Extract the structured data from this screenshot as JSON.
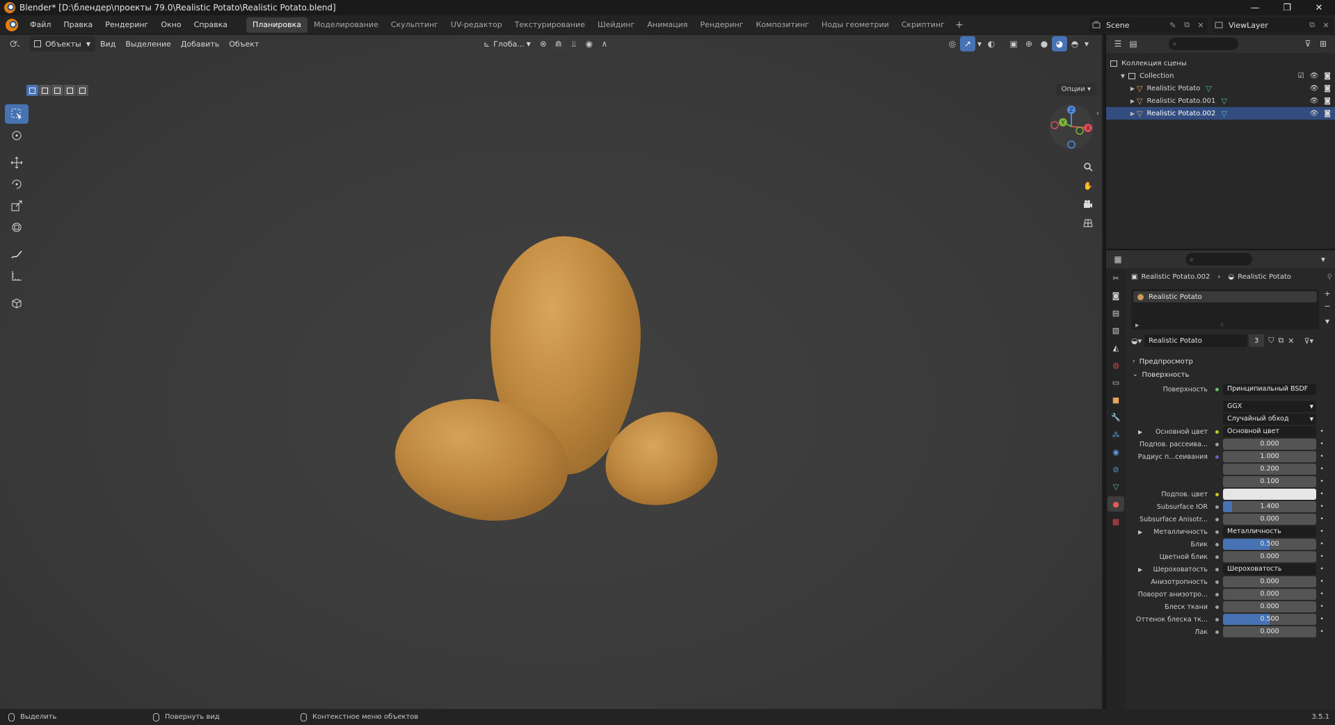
{
  "window": {
    "title": "Blender* [D:\\блендер\\проекты 79.0\\Realistic Potato\\Realistic Potato.blend]",
    "controls": [
      "—",
      "❐",
      "✕"
    ]
  },
  "menu": [
    "Файл",
    "Правка",
    "Рендеринг",
    "Окно",
    "Справка"
  ],
  "workspaces": {
    "tabs": [
      "Планировка",
      "Моделирование",
      "Скульптинг",
      "UV-редактор",
      "Текстурирование",
      "Шейдинг",
      "Анимация",
      "Рендеринг",
      "Композитинг",
      "Ноды геометрии",
      "Скриптинг"
    ],
    "active": "Планировка",
    "plus": "+"
  },
  "scene": {
    "name": "Scene"
  },
  "view_layer": {
    "name": "ViewLayer"
  },
  "viewport": {
    "mode": "Объекты",
    "menus": [
      "Вид",
      "Выделение",
      "Добавить",
      "Объект"
    ],
    "orientation": "Глоба...",
    "options_label": "Опции"
  },
  "gizmo": {
    "x": "X",
    "y": "Y",
    "z": "Z"
  },
  "outliner": {
    "root": "Коллекция сцены",
    "collection": "Collection",
    "objects": [
      {
        "name": "Realistic Potato",
        "selected": false
      },
      {
        "name": "Realistic Potato.001",
        "selected": false
      },
      {
        "name": "Realistic Potato.002",
        "selected": true
      }
    ]
  },
  "properties": {
    "breadcrumb": {
      "object": "Realistic Potato.002",
      "material": "Realistic Potato"
    },
    "slot": "Realistic Potato",
    "material_name": "Realistic Potato",
    "material_users": "3",
    "panels": {
      "preview": "Предпросмотр",
      "surface": "Поверхность"
    },
    "surface_label": "Поверхность",
    "surface_shader": "Принципиальный BSDF",
    "distribution": "GGX",
    "subsurface_method": "Случайный обход",
    "rows": [
      {
        "label": "Основной цвет",
        "value": "Основной цвет",
        "kind": "link",
        "dot": "col",
        "expander": true
      },
      {
        "label": "Подпов. рассеива...",
        "value": "0.000",
        "kind": "num",
        "dot": "flt"
      },
      {
        "label": "Радиус п...сеивания",
        "value": "1.000",
        "kind": "num",
        "dot": "vec"
      },
      {
        "label": "",
        "value": "0.200",
        "kind": "num",
        "dot": ""
      },
      {
        "label": "",
        "value": "0.100",
        "kind": "num",
        "dot": ""
      },
      {
        "label": "Подпов. цвет",
        "value": "",
        "kind": "color",
        "dot": "col"
      },
      {
        "label": "Subsurface IOR",
        "value": "1.400",
        "kind": "num",
        "dot": "flt",
        "fill": 0.1
      },
      {
        "label": "Subsurface Anisotr...",
        "value": "0.000",
        "kind": "num",
        "dot": "flt"
      },
      {
        "label": "Металличность",
        "value": "Металличность",
        "kind": "link",
        "dot": "flt",
        "expander": true
      },
      {
        "label": "Блик",
        "value": "0.500",
        "kind": "num",
        "dot": "flt",
        "fill": 0.5
      },
      {
        "label": "Цветной блик",
        "value": "0.000",
        "kind": "num",
        "dot": "flt"
      },
      {
        "label": "Шероховатость",
        "value": "Шероховатость",
        "kind": "link",
        "dot": "flt",
        "expander": true
      },
      {
        "label": "Анизотропность",
        "value": "0.000",
        "kind": "num",
        "dot": "flt"
      },
      {
        "label": "Поворот анизотро...",
        "value": "0.000",
        "kind": "num",
        "dot": "flt"
      },
      {
        "label": "Блеск ткани",
        "value": "0.000",
        "kind": "num",
        "dot": "flt"
      },
      {
        "label": "Оттенок блеска тк...",
        "value": "0.500",
        "kind": "num",
        "dot": "flt",
        "fill": 0.5
      },
      {
        "label": "Лак",
        "value": "0.000",
        "kind": "num",
        "dot": "flt"
      }
    ]
  },
  "status": {
    "select": "Выделить",
    "rotate": "Повернуть вид",
    "context": "Контекстное меню объектов",
    "version": "3.5.1"
  }
}
